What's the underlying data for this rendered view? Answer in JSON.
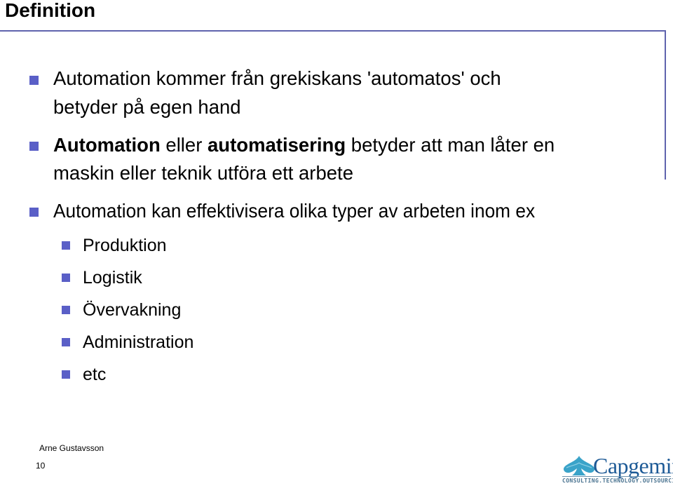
{
  "slide": {
    "title": "Definition",
    "bullets": [
      {
        "lines": [
          "Automation kommer från grekiskans 'automatos' och",
          "betyder på egen hand"
        ]
      },
      {
        "line1": [
          {
            "text": "Automation",
            "bold": true
          },
          {
            "text": " eller ",
            "bold": false
          },
          {
            "text": "automatisering",
            "bold": true
          },
          {
            "text": " betyder att man låter en",
            "bold": false
          }
        ],
        "line2": "maskin eller teknik utföra ett arbete"
      },
      {
        "text": "Automation kan effektivisera olika typer av arbeten inom ex",
        "sub_items": [
          "Produktion",
          "Logistik",
          "Övervakning",
          "Administration",
          "etc"
        ]
      }
    ],
    "bullet_icon": "square-bullet-icon",
    "accent_color": "#5a5fc7",
    "rule_color": "#5f63ad"
  },
  "footer": {
    "author": "Arne Gustavsson",
    "page_number": "10"
  },
  "logo": {
    "name": "Capgemini",
    "tagline": "CONSULTING.TECHNOLOGY.OUTSOURCING",
    "icon": "spade-icon",
    "brand_color": "#1d5a96",
    "icon_color": "#3aa3c9"
  }
}
